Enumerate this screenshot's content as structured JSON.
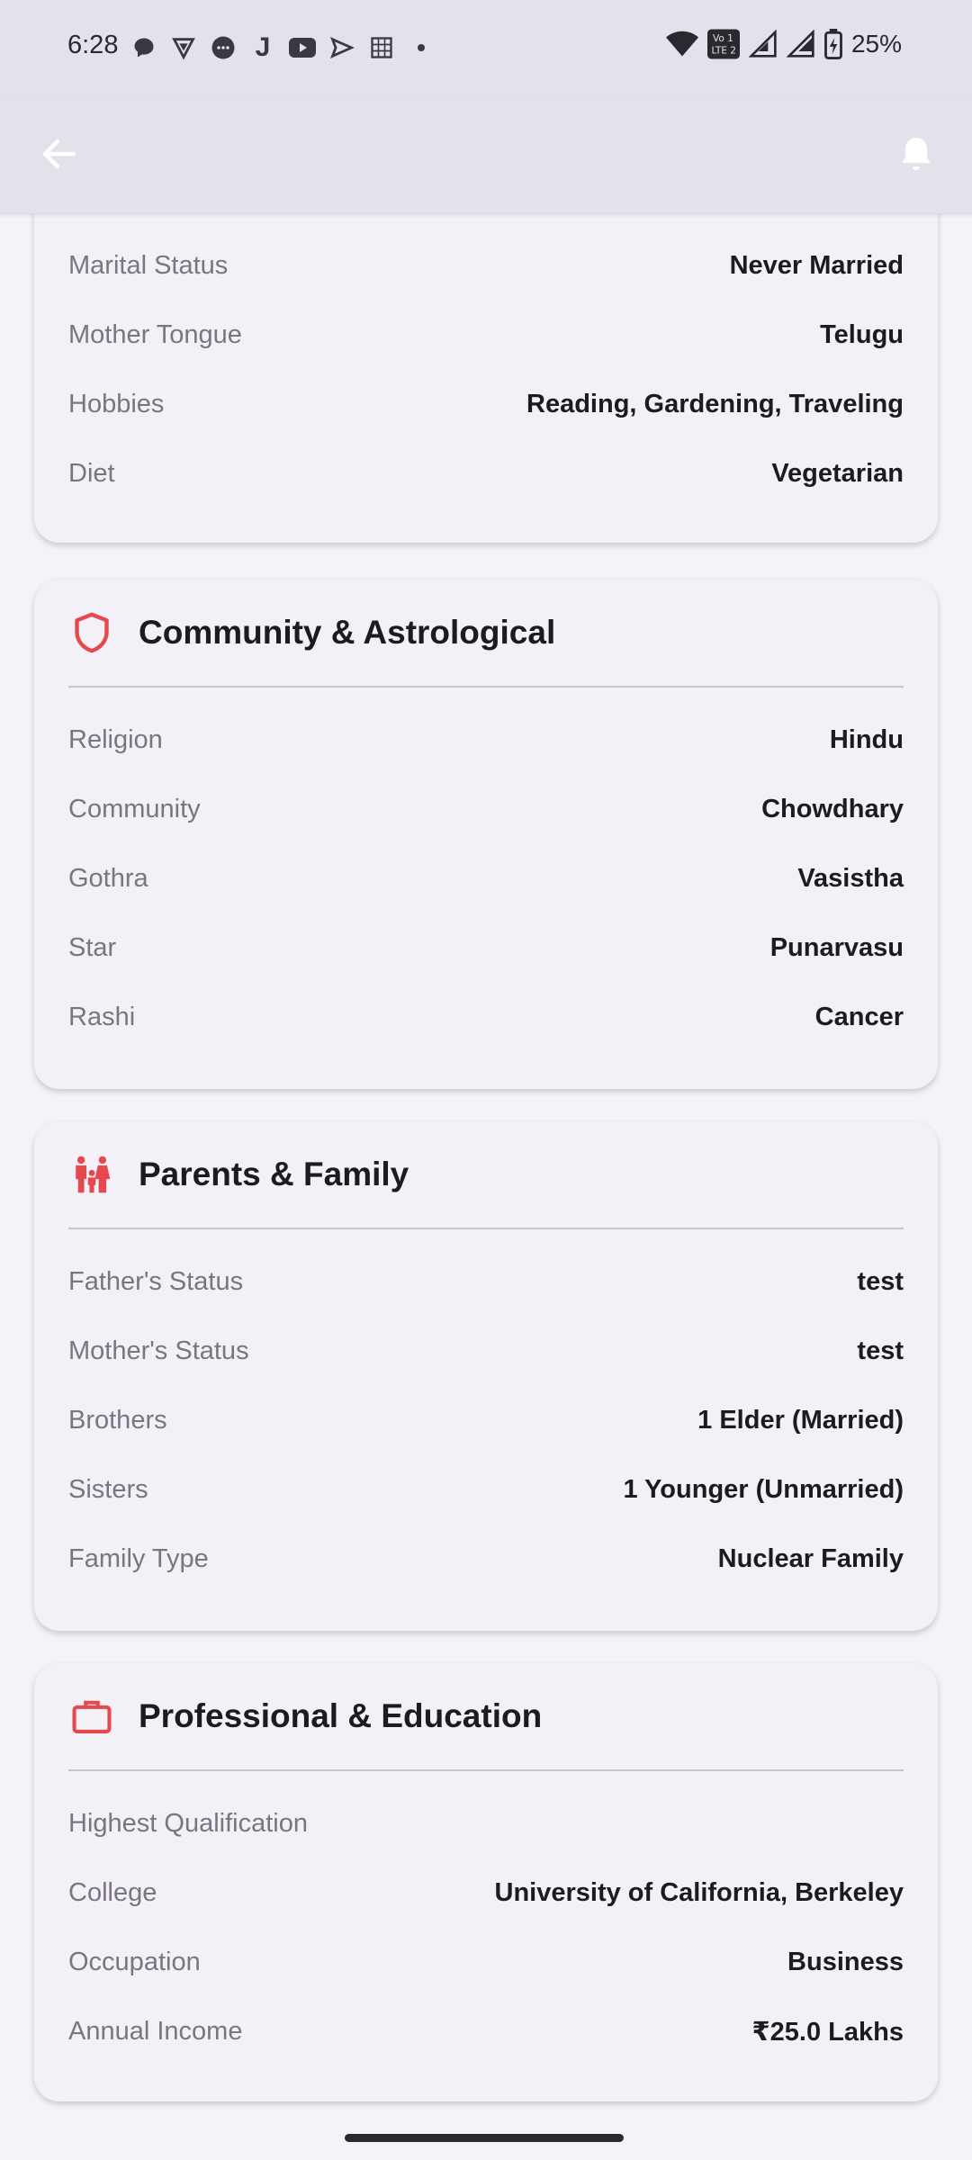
{
  "status_bar": {
    "time": "6:28",
    "battery": "25%",
    "left_icons": [
      "chat-icon",
      "vpn-icon",
      "message-icon",
      "j-app-icon",
      "youtube-icon",
      "send-icon",
      "calendar-icon",
      "dot-icon"
    ]
  },
  "app_bar": {
    "back_icon": "arrow-left-icon",
    "notification_icon": "bell-icon"
  },
  "personal_card": {
    "rows": [
      {
        "label": "Marital Status",
        "value": "Never Married"
      },
      {
        "label": "Mother Tongue",
        "value": "Telugu"
      },
      {
        "label": "Hobbies",
        "value": "Reading, Gardening, Traveling"
      },
      {
        "label": "Diet",
        "value": "Vegetarian"
      }
    ]
  },
  "community_card": {
    "title": "Community & Astrological",
    "icon": "shield-icon",
    "rows": [
      {
        "label": "Religion",
        "value": "Hindu"
      },
      {
        "label": "Community",
        "value": "Chowdhary"
      },
      {
        "label": "Gothra",
        "value": "Vasistha"
      },
      {
        "label": "Star",
        "value": "Punarvasu"
      },
      {
        "label": "Rashi",
        "value": "Cancer"
      }
    ]
  },
  "family_card": {
    "title": "Parents & Family",
    "icon": "family-icon",
    "rows": [
      {
        "label": "Father's Status",
        "value": "test"
      },
      {
        "label": "Mother's Status",
        "value": "test"
      },
      {
        "label": "Brothers",
        "value": "1 Elder (Married)"
      },
      {
        "label": "Sisters",
        "value": "1 Younger (Unmarried)"
      },
      {
        "label": "Family Type",
        "value": "Nuclear Family"
      }
    ]
  },
  "professional_card": {
    "title": "Professional & Education",
    "icon": "briefcase-icon",
    "rows": [
      {
        "label": "Highest Qualification",
        "value": ""
      },
      {
        "label": "College",
        "value": "University of California, Berkeley"
      },
      {
        "label": "Occupation",
        "value": "Business"
      },
      {
        "label": "Annual Income",
        "value": "₹25.0 Lakhs"
      }
    ]
  },
  "colors": {
    "accent": "#e5484d",
    "background": "#f5f2fa",
    "app_bar": "#e4e1ea"
  }
}
